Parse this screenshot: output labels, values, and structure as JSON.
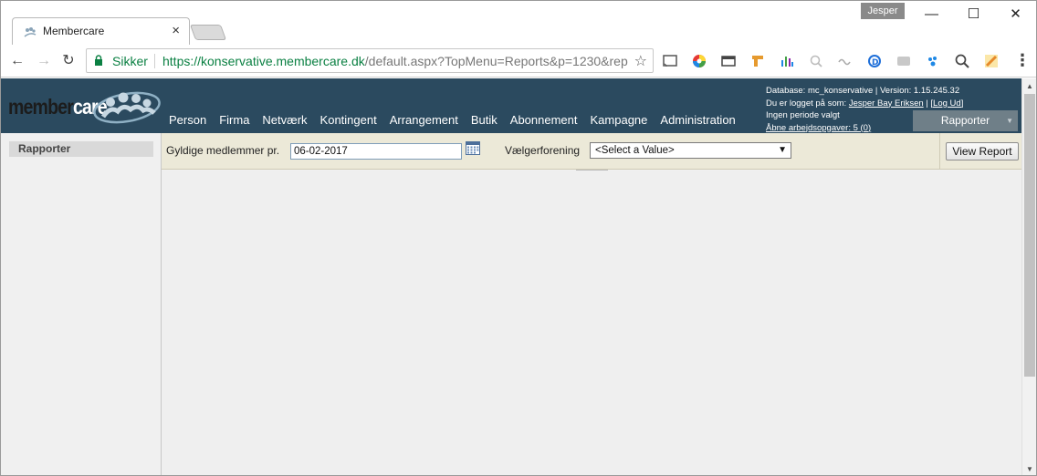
{
  "browser": {
    "tab_title": "Membercare",
    "profile_name": "Jesper",
    "security_label": "Sikker",
    "url_host": "https://konservative.membercare.dk",
    "url_path": "/default.aspx?TopMenu=Reports&p=1230&rep"
  },
  "app": {
    "logo_member": "member",
    "logo_care": "care",
    "nav": [
      "Person",
      "Firma",
      "Netværk",
      "Kontingent",
      "Arrangement",
      "Butik",
      "Abonnement",
      "Kampagne",
      "Administration"
    ],
    "info": {
      "database_line": "Database: mc_konservative | Version: 1.15.245.32",
      "logged_in_prefix": "Du er logget på som:",
      "user_name": "Jesper Bay Eriksen",
      "logout": "[Log Ud]",
      "period": "Ingen periode valgt",
      "open_tasks": "Åbne arbejdsopgaver: 5 (0)"
    },
    "section_button": "Rapporter"
  },
  "sidebar": {
    "items": [
      "Rapporter"
    ]
  },
  "report": {
    "param1_label": "Gyldige medlemmer pr.",
    "param1_value": "06-02-2017",
    "param2_label": "Vælgerforening",
    "param2_value": "<Select a Value>",
    "view_button": "View Report"
  },
  "colors": {
    "header_bg": "#2b4a5f",
    "params_bg": "#ece9d8",
    "secure_green": "#0b8043"
  }
}
